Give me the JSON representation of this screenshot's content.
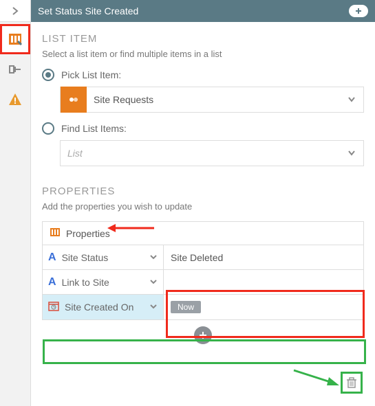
{
  "header": {
    "title": "Set Status Site Created"
  },
  "sidebar": {
    "tabs": [
      {
        "name": "list-tab"
      },
      {
        "name": "form-tab"
      },
      {
        "name": "warning-tab"
      }
    ]
  },
  "listItem": {
    "section_title": "LIST ITEM",
    "subtitle": "Select a list item or find multiple items in a list",
    "pick_label": "Pick List Item:",
    "find_label": "Find List Items:",
    "pick_value": "Site Requests",
    "find_placeholder": "List"
  },
  "properties": {
    "section_title": "PROPERTIES",
    "subtitle": "Add the properties you wish to update",
    "header_label": "Properties",
    "rows": [
      {
        "icon": "A",
        "key": "Site Status",
        "value": "Site Deleted"
      },
      {
        "icon": "A",
        "key": "Link to Site",
        "value": ""
      },
      {
        "icon": "cal",
        "key": "Site Created On",
        "value_chip": "Now"
      }
    ]
  },
  "colors": {
    "accent_teal": "#5a7a85",
    "accent_orange": "#e87d1e",
    "hl_red": "#f02a1c",
    "hl_green": "#36b24a"
  }
}
